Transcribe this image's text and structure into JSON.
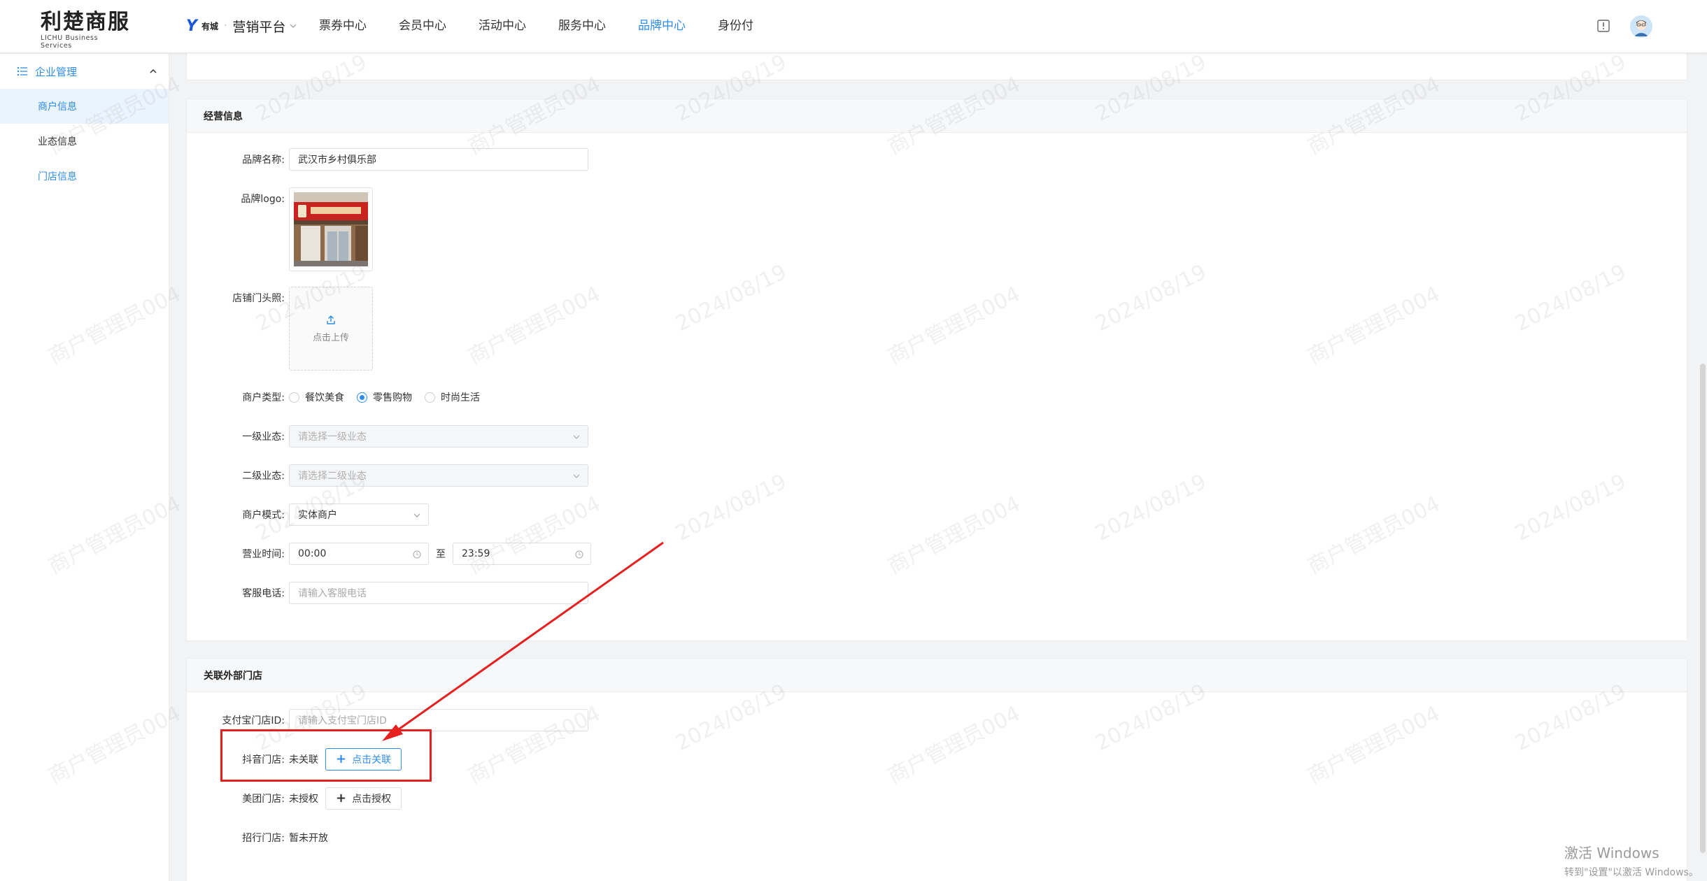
{
  "header": {
    "logo_main": "利楚商服",
    "logo_sub": "LICHU Business Services",
    "platform_brand": "有城",
    "platform_name": "营销平台",
    "nav": [
      "票券中心",
      "会员中心",
      "活动中心",
      "服务中心",
      "品牌中心",
      "身份付"
    ],
    "active_nav": "品牌中心"
  },
  "sidebar": {
    "group_label": "企业管理",
    "items": [
      "商户信息",
      "业态信息",
      "门店信息"
    ],
    "selected": "商户信息"
  },
  "business_info": {
    "title": "经营信息",
    "brand_name_label": "品牌名称:",
    "brand_name_value": "武汉市乡村俱乐部",
    "brand_logo_label": "品牌logo:",
    "storefront_label": "店铺门头照:",
    "upload_text": "点击上传",
    "merchant_type_label": "商户类型:",
    "merchant_types": [
      "餐饮美食",
      "零售购物",
      "时尚生活"
    ],
    "merchant_type_selected": "零售购物",
    "primary_format_label": "一级业态:",
    "primary_format_placeholder": "请选择一级业态",
    "secondary_format_label": "二级业态:",
    "secondary_format_placeholder": "请选择二级业态",
    "merchant_mode_label": "商户模式:",
    "merchant_mode_value": "实体商户",
    "hours_label": "营业时间:",
    "hours_start": "00:00",
    "hours_to": "至",
    "hours_end": "23:59",
    "service_phone_label": "客服电话:",
    "service_phone_placeholder": "请输入客服电话"
  },
  "external_store": {
    "title": "关联外部门店",
    "alipay_label": "支付宝门店ID:",
    "alipay_placeholder": "请输入支付宝门店ID",
    "douyin_label": "抖音门店:",
    "douyin_status": "未关联",
    "douyin_button": "点击关联",
    "meituan_label": "美团门店:",
    "meituan_status": "未授权",
    "meituan_button": "点击授权",
    "zhaoxing_label": "招行门店:",
    "zhaoxing_status": "暂未开放"
  },
  "watermark": {
    "user": "商户管理员004",
    "date": "2024/08/19"
  },
  "windows_activation": {
    "line1": "激活 Windows",
    "line2": "转到\"设置\"以激活 Windows。"
  },
  "colors": {
    "accent": "#2f8ce8",
    "annotation": "#e61f1f"
  }
}
